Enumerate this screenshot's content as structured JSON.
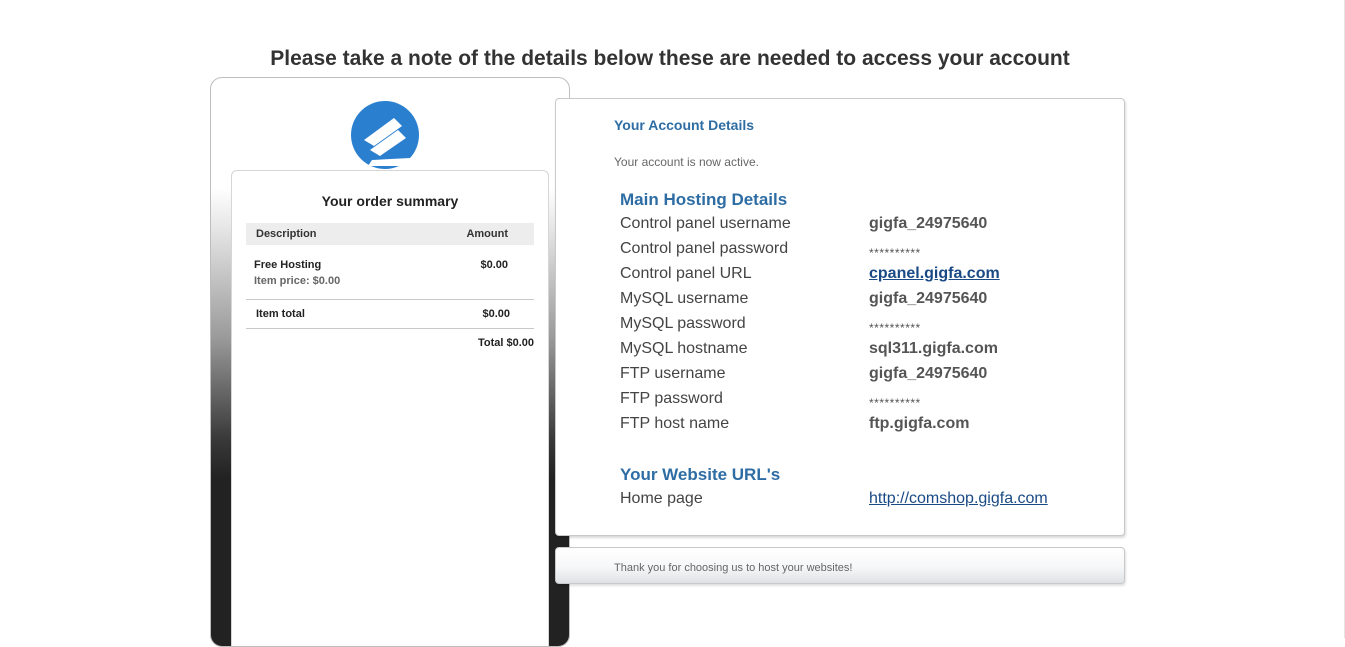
{
  "headline": "Please take a note of the details below these are needed to access your account",
  "account": {
    "title": "Your Account Details",
    "status": "Your account is now active.",
    "main_heading": "Main Hosting Details",
    "rows": [
      {
        "label": "Control panel username",
        "value": "gigfa_24975640"
      },
      {
        "label": "Control panel password",
        "value": "**********"
      },
      {
        "label": "Control panel URL",
        "value": "cpanel.gigfa.com"
      },
      {
        "label": "MySQL username",
        "value": "gigfa_24975640"
      },
      {
        "label": "MySQL password",
        "value": "**********"
      },
      {
        "label": "MySQL hostname",
        "value": "sql311.gigfa.com"
      },
      {
        "label": "FTP username",
        "value": "gigfa_24975640"
      },
      {
        "label": "FTP password",
        "value": "**********"
      },
      {
        "label": "FTP host name",
        "value": "ftp.gigfa.com"
      }
    ],
    "website_heading": "Your Website URL's",
    "website_rows": [
      {
        "label": "Home page",
        "value": "http://comshop.gigfa.com"
      }
    ]
  },
  "footer": {
    "text": "Thank you for choosing us to host your websites!"
  },
  "order": {
    "title": "Your order summary",
    "col_description": "Description",
    "col_amount": "Amount",
    "item_name": "Free Hosting",
    "item_price": "Item price: $0.00",
    "item_amount": "$0.00",
    "item_total_label": "Item total",
    "item_total_value": "$0.00",
    "grand_total": "Total $0.00"
  },
  "colors": {
    "accent": "#2e6da4",
    "link": "#1a4a85",
    "logo": "#2a7fcf"
  }
}
